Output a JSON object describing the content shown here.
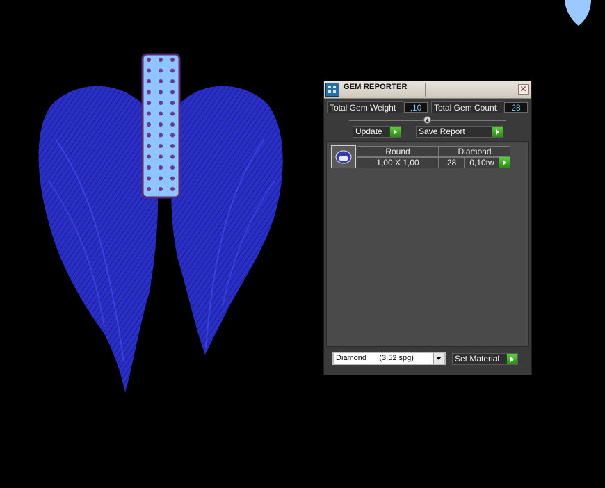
{
  "panel": {
    "title": "GEM REPORTER",
    "close_glyph": "✕",
    "total_weight_label": "Total Gem Weight",
    "total_weight_value": ",10",
    "total_count_label": "Total Gem Count",
    "total_count_value": "28",
    "update_label": "Update",
    "save_report_label": "Save Report",
    "set_material_label": "Set Material",
    "material_selected": "Diamond      (3,52 spg)"
  },
  "gem_list": {
    "rows": [
      {
        "shape": "Round",
        "material": "Diamond",
        "size": "1,00 X 1,00",
        "count": "28",
        "weight": "0,10tw"
      }
    ]
  },
  "icons": {
    "app_icon": "gem-reporter-icon",
    "close": "close-icon",
    "go": "play-arrow-icon",
    "collapse": "collapse-up-icon",
    "dropdown": "chevron-down-icon",
    "gem_thumb": "round-gem-icon"
  },
  "colors": {
    "wing": "#2a2fc8",
    "bar": "#8fc4ff",
    "gem_dot": "#6a3a8c",
    "go_button": "#3fb020",
    "value_text": "#7fc8e8"
  }
}
